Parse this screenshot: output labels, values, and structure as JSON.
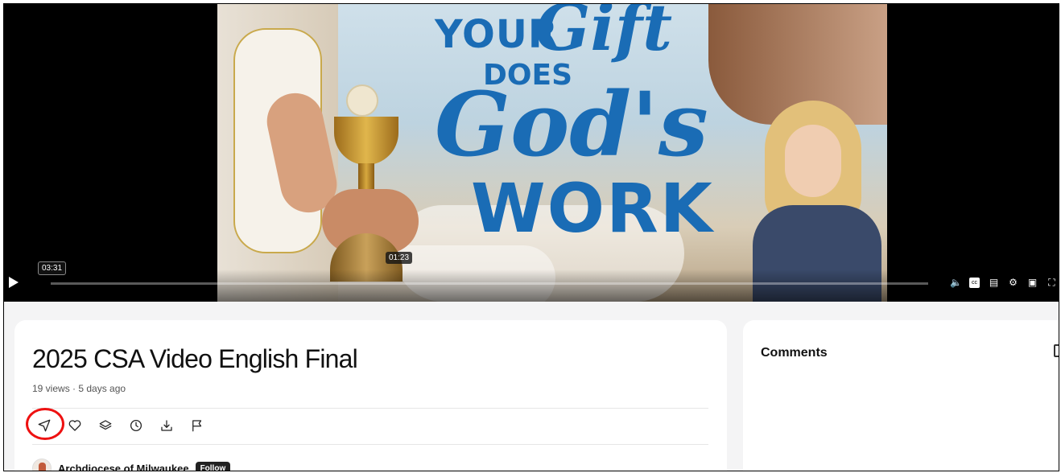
{
  "player": {
    "hover_time": "03:31",
    "thumb_time": "01:23",
    "poster_text": {
      "line1": "YOUR",
      "line2": "Gift",
      "line3": "DOES",
      "line4": "God's",
      "line5": "WORK"
    },
    "controls": [
      "play-icon",
      "volume-icon",
      "captions-icon",
      "transcript-icon",
      "settings-icon",
      "pip-icon",
      "fullscreen-icon"
    ]
  },
  "video": {
    "title": "2025 CSA Video English Final",
    "meta": "19 views · 5 days ago",
    "actions": [
      "share-icon",
      "heart-icon",
      "layers-icon",
      "clock-icon",
      "download-icon",
      "flag-icon"
    ]
  },
  "channel": {
    "name": "Archdiocese of Milwaukee",
    "follow_label": "Follow"
  },
  "comments": {
    "title": "Comments"
  },
  "colors": {
    "highlight": "#e11111",
    "poster_blue": "#1a6cb5"
  }
}
